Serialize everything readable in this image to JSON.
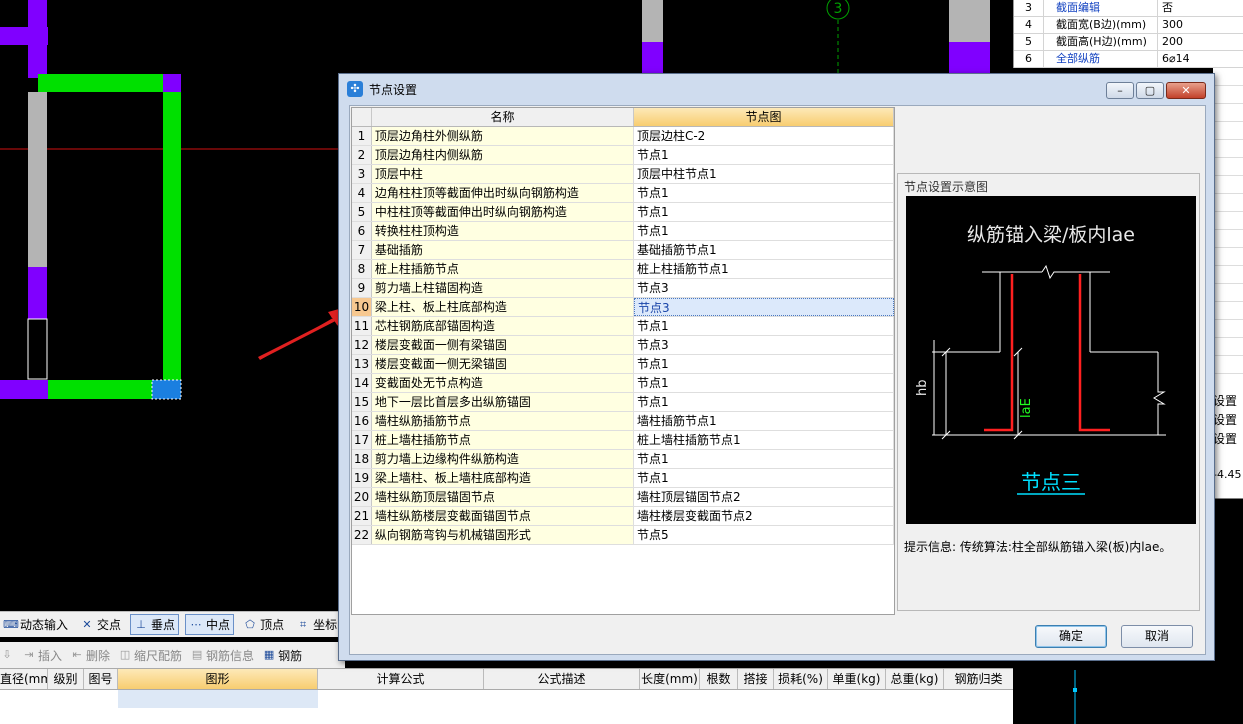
{
  "right_panel": {
    "rows": [
      {
        "n": "3",
        "k": "截面编辑",
        "v": "否",
        "blue": true
      },
      {
        "n": "4",
        "k": "截面宽(B边)(mm)",
        "v": "300",
        "blue": false
      },
      {
        "n": "5",
        "k": "截面高(H边)(mm)",
        "v": "200",
        "blue": false
      },
      {
        "n": "6",
        "k": "全部纵筋",
        "v": "6⌀14",
        "blue": true
      }
    ],
    "side_labels": [
      "设置",
      "设置",
      "设置"
    ],
    "side_value": "-4.45"
  },
  "cad": {
    "axis_label": "3"
  },
  "toolbar1": {
    "items": [
      "动态输入",
      "交点",
      "垂点",
      "中点",
      "顶点",
      "坐标"
    ]
  },
  "toolbar2": {
    "items": [
      "插入",
      "删除",
      "缩尺配筋",
      "钢筋信息",
      "钢筋"
    ]
  },
  "bottom_grid": {
    "columns": [
      "直径(mm)",
      "级别",
      "图号",
      "图形",
      "计算公式",
      "公式描述",
      "长度(mm)",
      "根数",
      "搭接",
      "损耗(%)",
      "单重(kg)",
      "总重(kg)",
      "钢筋归类"
    ]
  },
  "dialog": {
    "title": "节点设置",
    "table": {
      "col_name": "名称",
      "col_pic": "节点图",
      "rows": [
        {
          "n": "1",
          "name": "顶层边角柱外侧纵筋",
          "pic": "顶层边柱C-2"
        },
        {
          "n": "2",
          "name": "顶层边角柱内侧纵筋",
          "pic": "节点1"
        },
        {
          "n": "3",
          "name": "顶层中柱",
          "pic": "顶层中柱节点1"
        },
        {
          "n": "4",
          "name": "边角柱柱顶等截面伸出时纵向钢筋构造",
          "pic": "节点1"
        },
        {
          "n": "5",
          "name": "中柱柱顶等截面伸出时纵向钢筋构造",
          "pic": "节点1"
        },
        {
          "n": "6",
          "name": "转换柱柱顶构造",
          "pic": "节点1"
        },
        {
          "n": "7",
          "name": "基础插筋",
          "pic": "基础插筋节点1"
        },
        {
          "n": "8",
          "name": "桩上柱插筋节点",
          "pic": "桩上柱插筋节点1"
        },
        {
          "n": "9",
          "name": "剪力墙上柱锚固构造",
          "pic": "节点3"
        },
        {
          "n": "10",
          "name": "梁上柱、板上柱底部构造",
          "pic": "节点3"
        },
        {
          "n": "11",
          "name": "芯柱钢筋底部锚固构造",
          "pic": "节点1"
        },
        {
          "n": "12",
          "name": "楼层变截面一侧有梁锚固",
          "pic": "节点3"
        },
        {
          "n": "13",
          "name": "楼层变截面一侧无梁锚固",
          "pic": "节点1"
        },
        {
          "n": "14",
          "name": "变截面处无节点构造",
          "pic": "节点1"
        },
        {
          "n": "15",
          "name": "地下一层比首层多出纵筋锚固",
          "pic": "节点1"
        },
        {
          "n": "16",
          "name": "墙柱纵筋插筋节点",
          "pic": "墙柱插筋节点1"
        },
        {
          "n": "17",
          "name": "桩上墙柱插筋节点",
          "pic": "桩上墙柱插筋节点1"
        },
        {
          "n": "18",
          "name": "剪力墙上边缘构件纵筋构造",
          "pic": "节点1"
        },
        {
          "n": "19",
          "name": "梁上墙柱、板上墙柱底部构造",
          "pic": "节点1"
        },
        {
          "n": "20",
          "name": "墙柱纵筋顶层锚固节点",
          "pic": "墙柱顶层锚固节点2"
        },
        {
          "n": "21",
          "name": "墙柱纵筋楼层变截面锚固节点",
          "pic": "墙柱楼层变截面节点2"
        },
        {
          "n": "22",
          "name": "纵向钢筋弯钩与机械锚固形式",
          "pic": "节点5"
        }
      ],
      "selected_index": 9
    },
    "preview": {
      "title": "节点设置示意图",
      "diagram_title": "纵筋锚入梁/板内lae",
      "label_hb": "hb",
      "label_lae": "laE",
      "caption": "节点三",
      "hint": "提示信息:  传统算法:柱全部纵筋锚入梁(板)内lae。"
    },
    "buttons": {
      "ok": "确定",
      "cancel": "取消"
    }
  }
}
